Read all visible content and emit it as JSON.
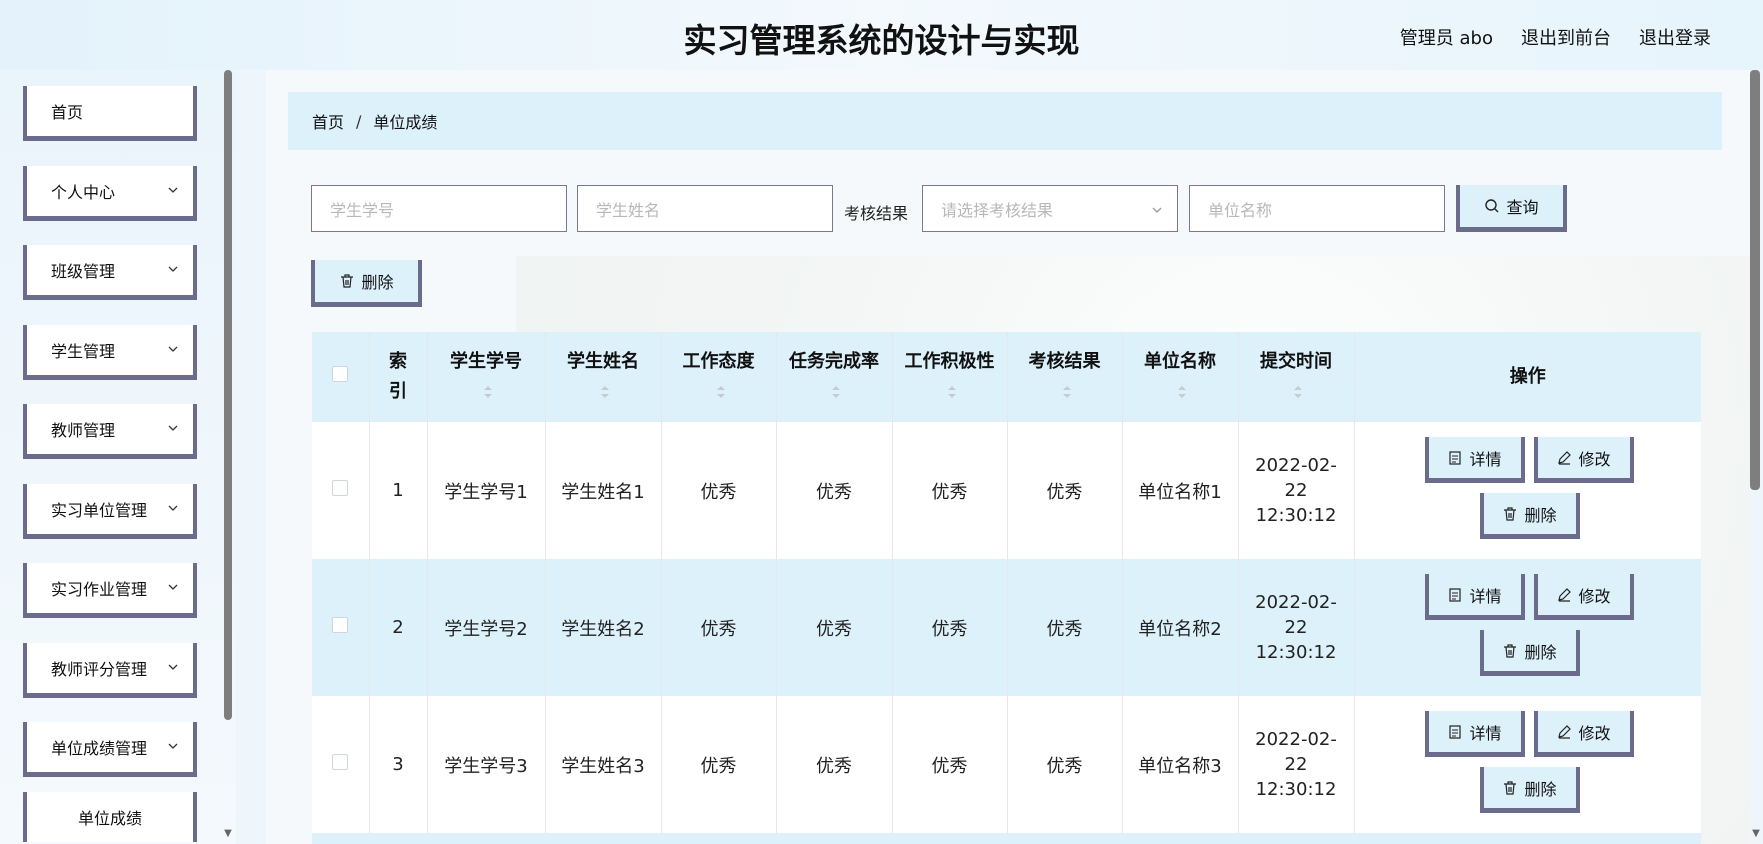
{
  "header": {
    "title": "实习管理系统的设计与实现",
    "user": "管理员 abo",
    "to_front": "退出到前台",
    "logout": "退出登录"
  },
  "sidebar": {
    "items": [
      {
        "label": "首页",
        "has_children": false
      },
      {
        "label": "个人中心",
        "has_children": true
      },
      {
        "label": "班级管理",
        "has_children": true
      },
      {
        "label": "学生管理",
        "has_children": true
      },
      {
        "label": "教师管理",
        "has_children": true
      },
      {
        "label": "实习单位管理",
        "has_children": true
      },
      {
        "label": "实习作业管理",
        "has_children": true
      },
      {
        "label": "教师评分管理",
        "has_children": true
      },
      {
        "label": "单位成绩管理",
        "has_children": true
      }
    ],
    "submenu": {
      "label": "单位成绩"
    }
  },
  "breadcrumb": {
    "home": "首页",
    "separator": "/",
    "current": "单位成绩"
  },
  "search": {
    "student_id_placeholder": "学生学号",
    "student_name_placeholder": "学生姓名",
    "result_label": "考核结果",
    "result_placeholder": "请选择考核结果",
    "unit_name_placeholder": "单位名称",
    "query_button": "查询"
  },
  "toolbar": {
    "delete_button": "删除"
  },
  "table": {
    "headers": {
      "index": "索引",
      "student_id": "学生学号",
      "student_name": "学生姓名",
      "attitude": "工作态度",
      "completion": "任务完成率",
      "initiative": "工作积极性",
      "result": "考核结果",
      "unit_name": "单位名称",
      "submit_time": "提交时间",
      "actions": "操作"
    },
    "rows": [
      {
        "index": "1",
        "student_id": "学生学号1",
        "student_name": "学生姓名1",
        "attitude": "优秀",
        "completion": "优秀",
        "initiative": "优秀",
        "result": "优秀",
        "unit_name": "单位名称1",
        "submit_time": "2022-02-22 12:30:12"
      },
      {
        "index": "2",
        "student_id": "学生学号2",
        "student_name": "学生姓名2",
        "attitude": "优秀",
        "completion": "优秀",
        "initiative": "优秀",
        "result": "优秀",
        "unit_name": "单位名称2",
        "submit_time": "2022-02-22 12:30:12"
      },
      {
        "index": "3",
        "student_id": "学生学号3",
        "student_name": "学生姓名3",
        "attitude": "优秀",
        "completion": "优秀",
        "initiative": "优秀",
        "result": "优秀",
        "unit_name": "单位名称3",
        "submit_time": "2022-02-22 12:30:12"
      }
    ],
    "row_actions": {
      "detail": "详情",
      "edit": "修改",
      "delete": "删除"
    }
  },
  "colors": {
    "accent_border": "#6b6b8c",
    "light_blue": "#ddf1fb"
  }
}
